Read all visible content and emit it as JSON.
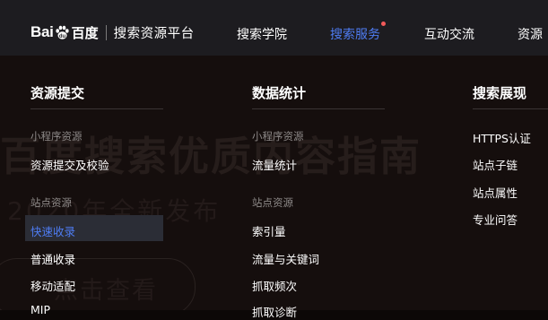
{
  "header": {
    "logo_text_bai": "Bai",
    "logo_text_du": "du",
    "logo_text_cn": "百度",
    "site_name": "搜索资源平台",
    "nav": [
      {
        "label": "搜索学院"
      },
      {
        "label": "搜索服务"
      },
      {
        "label": "互动交流"
      },
      {
        "label": "资源"
      }
    ]
  },
  "background": {
    "title": "百度搜索优质内容指南",
    "subtitle": "2020年全新发布",
    "button": "点击查看"
  },
  "menu": {
    "col1": {
      "heading": "资源提交",
      "group1": "小程序资源",
      "group1_items": [
        "资源提交及校验"
      ],
      "group2": "站点资源",
      "group2_items": [
        "快速收录",
        "普通收录",
        "移动适配",
        "MIP"
      ]
    },
    "col2": {
      "heading": "数据统计",
      "group1": "小程序资源",
      "group1_items": [
        "流量统计"
      ],
      "group2": "站点资源",
      "group2_items": [
        "索引量",
        "流量与关键词",
        "抓取频次",
        "抓取诊断"
      ]
    },
    "col3": {
      "heading": "搜索展现",
      "items": [
        "HTTPS认证",
        "站点子链",
        "站点属性",
        "专业问答"
      ]
    }
  },
  "colors": {
    "accent": "#4e7cf2",
    "notification_dot": "#f25a5a",
    "topbar": "#1d1c20",
    "panel": "#150e0d"
  }
}
